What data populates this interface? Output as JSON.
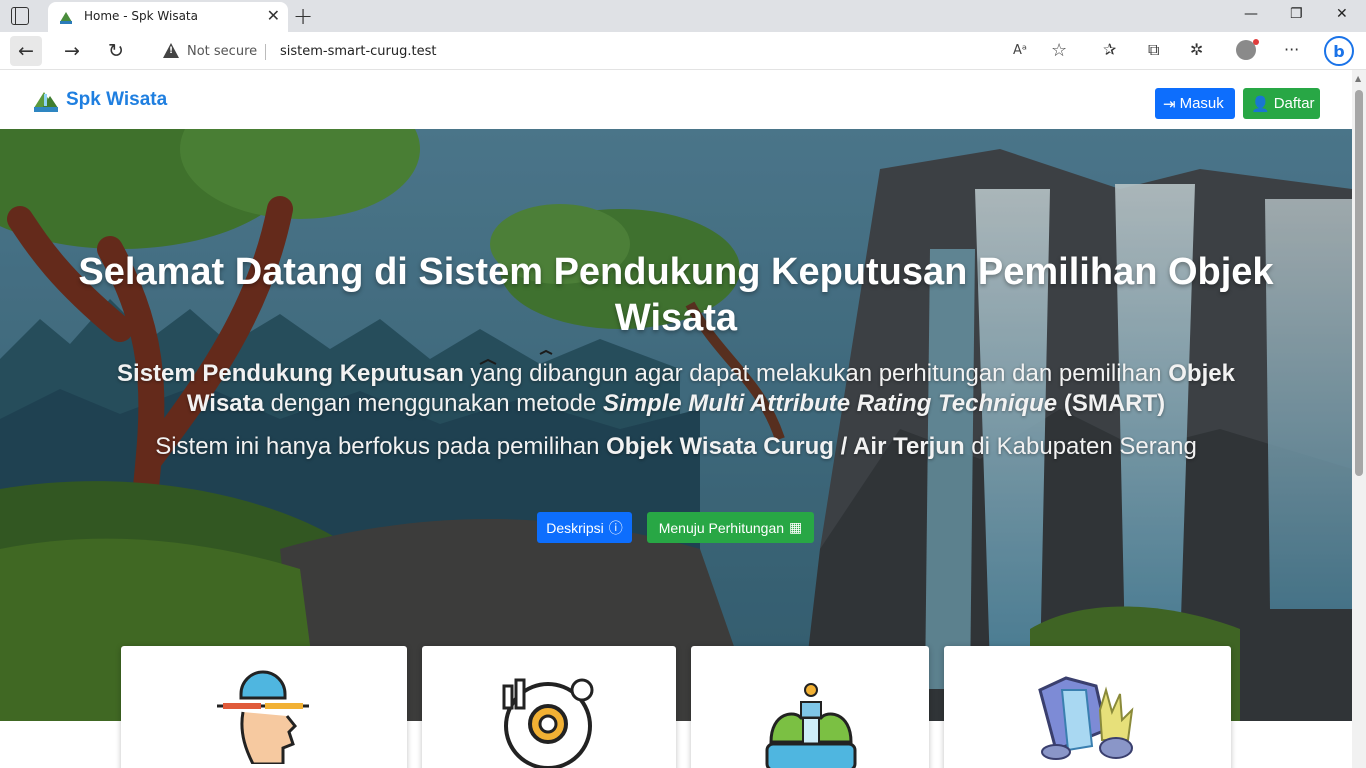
{
  "browser": {
    "tab_title": "Home - Spk Wisata",
    "not_secure_label": "Not secure",
    "url": "sistem-smart-curug.test"
  },
  "site": {
    "brand": "Spk Wisata",
    "login_label": "Masuk",
    "register_label": "Daftar"
  },
  "hero": {
    "title": "Selamat Datang di Sistem Pendukung Keputusan Pemilihan Objek Wisata",
    "sub1_bold1": "Sistem Pendukung Keputusan",
    "sub1_text1": " yang dibangun agar dapat melakukan perhitungan dan pemilihan ",
    "sub1_bold2": "Objek Wisata",
    "sub1_text2": " dengan menggunakan metode ",
    "sub1_italic": "Simple Multi Attribute Rating Technique",
    "sub1_bold3": " (SMART)",
    "sub2_text1": "Sistem ini hanya berfokus pada pemilihan ",
    "sub2_bold": "Objek Wisata Curug / Air Terjun",
    "sub2_text2": " di Kabupaten Serang",
    "btn_description": "Deskripsi",
    "btn_calculation": "Menuju Perhitungan"
  },
  "cards": [
    {
      "icon": "decision-head-icon"
    },
    {
      "icon": "analytics-gear-icon"
    },
    {
      "icon": "waterfall-icon"
    },
    {
      "icon": "waterfall-rocks-icon"
    }
  ]
}
